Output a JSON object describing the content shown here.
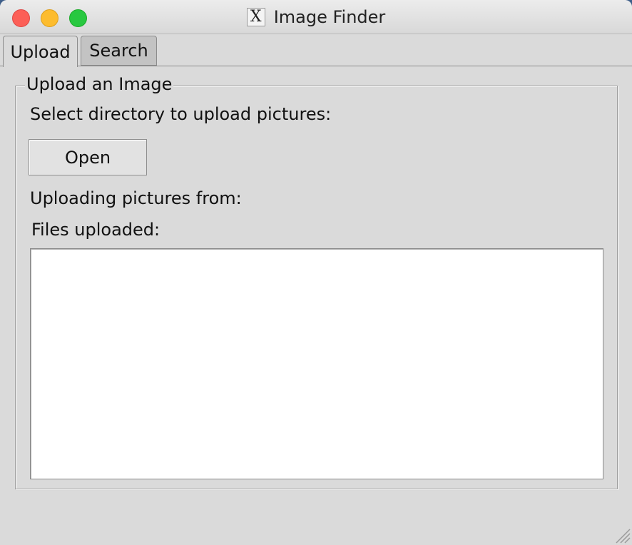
{
  "window": {
    "title": "Image Finder",
    "title_icon": "x11-icon",
    "title_icon_glyph": "X"
  },
  "tabs": [
    {
      "label": "Upload",
      "active": true
    },
    {
      "label": "Search",
      "active": false
    }
  ],
  "upload": {
    "group_title": "Upload an Image",
    "select_label": "Select directory to upload pictures:",
    "open_button": "Open",
    "uploading_from_label": "Uploading pictures from:",
    "files_uploaded_label": "Files uploaded:",
    "files": []
  }
}
